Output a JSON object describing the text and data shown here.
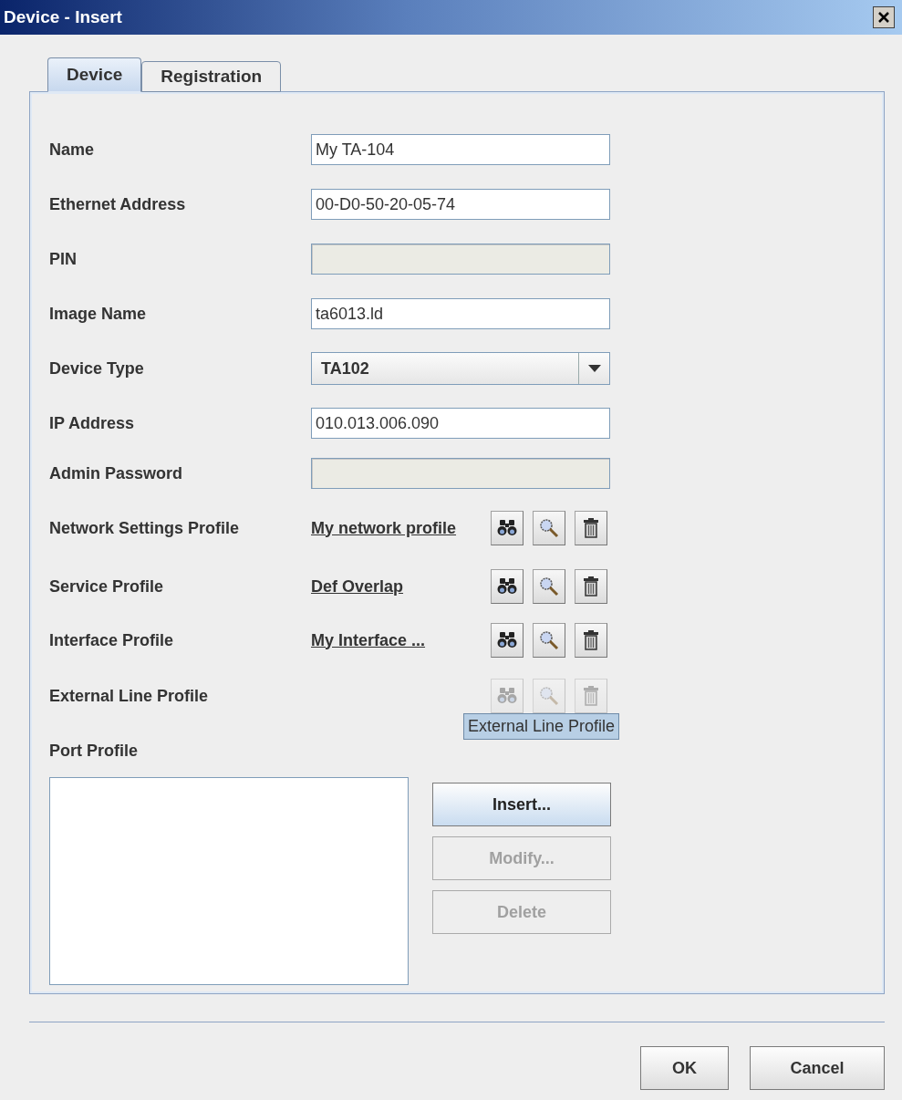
{
  "window": {
    "title": "Device - Insert"
  },
  "tabs": [
    {
      "label": "Device",
      "selected": true
    },
    {
      "label": "Registration",
      "selected": false
    }
  ],
  "fields": [
    {
      "kind": "text",
      "label": "Name",
      "value": "My TA-104",
      "disabled": false
    },
    {
      "kind": "text",
      "label": "Ethernet Address",
      "value": "00-D0-50-20-05-74",
      "disabled": false
    },
    {
      "kind": "text",
      "label": "PIN",
      "disabled": true
    },
    {
      "kind": "text",
      "label": "Image Name",
      "value": "ta6013.ld",
      "disabled": false
    },
    {
      "kind": "select",
      "label": "Device Type",
      "value": "TA102"
    },
    {
      "kind": "text",
      "label": "IP Address",
      "value": "010.013.006.090",
      "disabled": false
    },
    {
      "kind": "text",
      "label": "Admin Password",
      "disabled": true
    },
    {
      "kind": "profile",
      "label": "Network Settings Profile",
      "value": "My network profile",
      "disabled": false
    },
    {
      "kind": "profile",
      "label": "Service Profile",
      "value": "Def Overlap",
      "disabled": false
    },
    {
      "kind": "profile",
      "label": "Interface Profile",
      "value": "My Interface ...",
      "disabled": false
    },
    {
      "kind": "profile",
      "label": "External Line Profile",
      "disabled": true,
      "tooltip": "External Line Profile"
    },
    {
      "kind": "heading",
      "label": "Port Profile"
    }
  ],
  "port_profile": {
    "buttons": [
      {
        "label": "Insert...",
        "disabled": false
      },
      {
        "label": "Modify...",
        "disabled": true
      },
      {
        "label": "Delete",
        "disabled": true
      }
    ]
  },
  "buttons": [
    {
      "label": "OK"
    },
    {
      "label": "Cancel"
    }
  ]
}
